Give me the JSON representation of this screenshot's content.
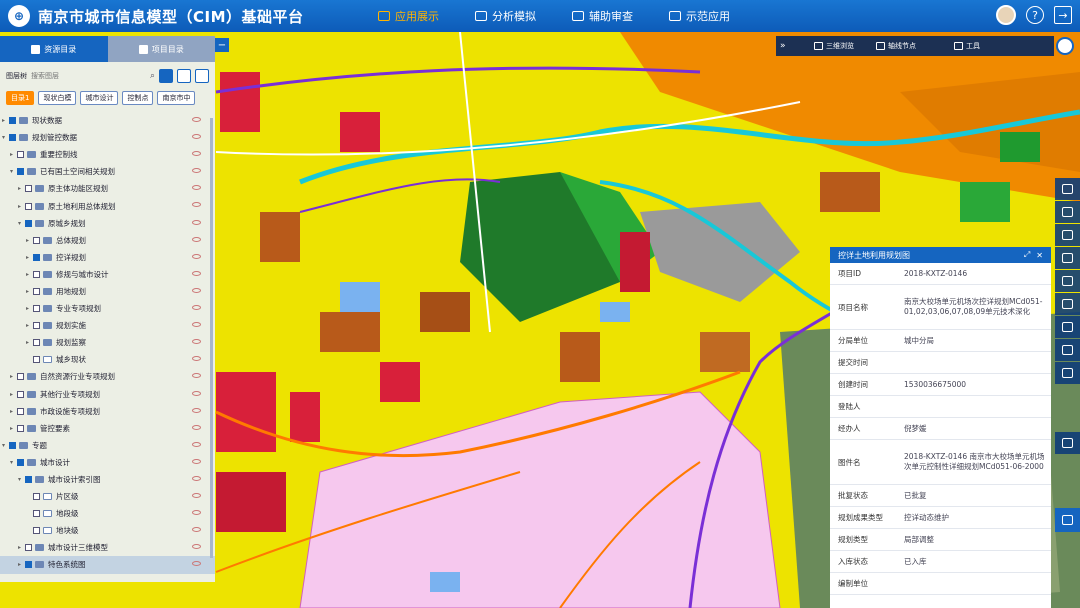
{
  "app": {
    "title": "南京市城市信息模型（CIM）基础平台"
  },
  "nav": [
    {
      "label": "应用展示"
    },
    {
      "label": "分析模拟"
    },
    {
      "label": "辅助审查"
    },
    {
      "label": "示范应用"
    }
  ],
  "panel": {
    "tabs": [
      {
        "label": "资源目录"
      },
      {
        "label": "项目目录"
      }
    ],
    "layer_select": "图层树",
    "search_placeholder": "搜索图层",
    "filters": [
      "目录1",
      "现状白模",
      "城市设计",
      "控制点",
      "南京市中"
    ],
    "tree": [
      {
        "label": "现状数据"
      },
      {
        "label": "规划管控数据"
      },
      {
        "label": "重要控制线"
      },
      {
        "label": "已有国土空间相关规划"
      },
      {
        "label": "原主体功能区规划"
      },
      {
        "label": "原土地利用总体规划"
      },
      {
        "label": "原城乡规划"
      },
      {
        "label": "总体规划"
      },
      {
        "label": "控详规划"
      },
      {
        "label": "修规与城市设计"
      },
      {
        "label": "用地规划"
      },
      {
        "label": "专业专项规划"
      },
      {
        "label": "规划实施"
      },
      {
        "label": "规划监察"
      },
      {
        "label": "城乡现状"
      },
      {
        "label": "自然资源行业专项规划"
      },
      {
        "label": "其他行业专项规划"
      },
      {
        "label": "市政设施专项规划"
      },
      {
        "label": "管控要素"
      },
      {
        "label": "专题"
      },
      {
        "label": "城市设计"
      },
      {
        "label": "城市设计索引图"
      },
      {
        "label": "片区级"
      },
      {
        "label": "地段级"
      },
      {
        "label": "地块级"
      },
      {
        "label": "城市设计三维模型"
      },
      {
        "label": "特色系统图"
      }
    ]
  },
  "toolbar": {
    "items": [
      {
        "label": "三维浏览"
      },
      {
        "label": "轴线节点"
      },
      {
        "label": "工具"
      }
    ]
  },
  "info": {
    "title": "控详土地利用规划图",
    "rows": [
      {
        "k": "项目ID",
        "v": "2018-KXTZ-0146"
      },
      {
        "k": "项目名称",
        "v": "南京大校场单元机场次控详规划MCd051-01,02,03,06,07,08,09单元技术深化"
      },
      {
        "k": "分局单位",
        "v": "城中分局"
      },
      {
        "k": "提交时间",
        "v": ""
      },
      {
        "k": "创建时间",
        "v": "1530036675000"
      },
      {
        "k": "登陆人",
        "v": ""
      },
      {
        "k": "经办人",
        "v": "倪梦媛"
      },
      {
        "k": "图件名",
        "v": "2018-KXTZ-0146 南京市大校场单元机场次单元控制性详细规划MCd051-06-2000"
      },
      {
        "k": "批复状态",
        "v": "已批复"
      },
      {
        "k": "规划成果类型",
        "v": "控详动态维护"
      },
      {
        "k": "规划类型",
        "v": "局部调整"
      },
      {
        "k": "入库状态",
        "v": "已入库"
      },
      {
        "k": "编制单位",
        "v": ""
      }
    ]
  },
  "colors": {
    "header": "#1565c0",
    "accent": "#ffb300",
    "map_yellow": "#f1e400",
    "map_orange": "#f08a00",
    "map_red": "#d8203a",
    "map_brown": "#b85a1a",
    "map_green": "#1f9a2f",
    "map_cyan": "#18c8d8",
    "map_purple": "#7a2fd6",
    "map_pink": "#f2a8e8"
  }
}
